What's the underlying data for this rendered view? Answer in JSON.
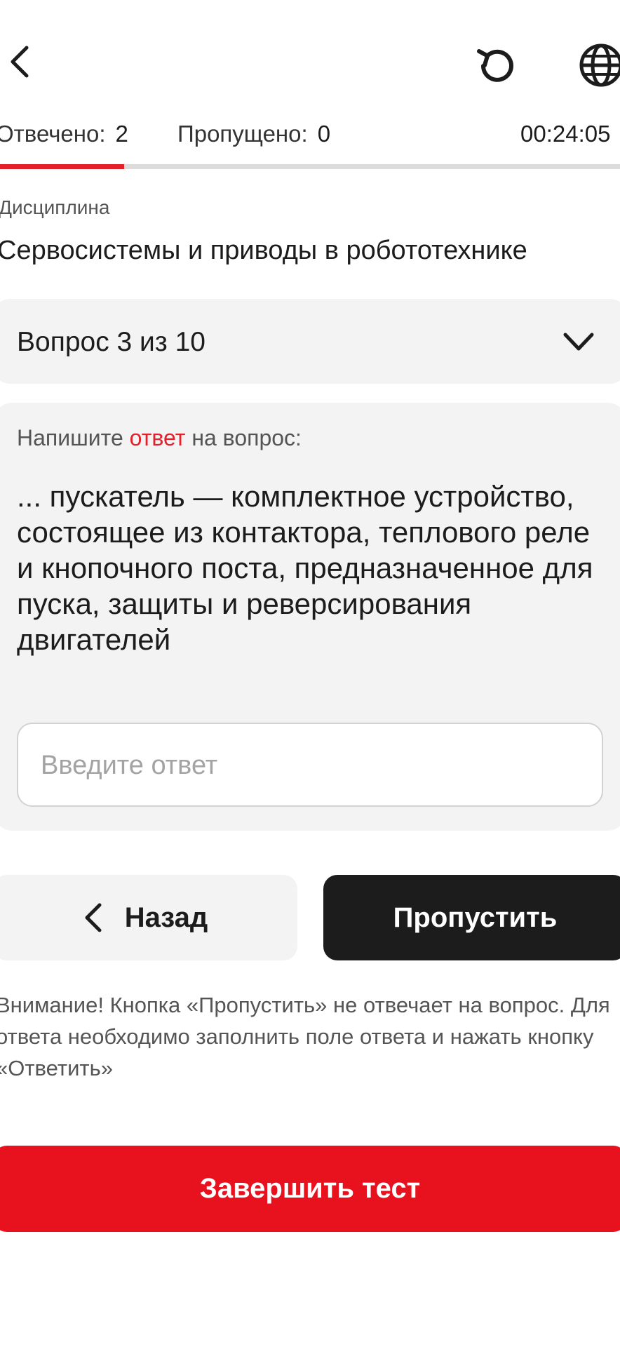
{
  "header": {
    "icons": {
      "back": "chevron-left-icon",
      "reset": "reset-icon",
      "language": "globe-icon"
    }
  },
  "progress": {
    "answered_label": "Отвечено:",
    "answered_value": "2",
    "skipped_label": "Пропущено:",
    "skipped_value": "0",
    "timer": "00:24:05",
    "fraction": 0.2,
    "accent_color": "#e3212b"
  },
  "discipline": {
    "label": "Дисциплина",
    "name": "Сервосистемы и приводы в робототехнике"
  },
  "question_selector": {
    "label": "Вопрос 3 из 10",
    "icon": "chevron-down-icon"
  },
  "question": {
    "prompt_before": "Напишите ",
    "prompt_highlight": "ответ",
    "prompt_after": " на вопрос:",
    "text": "... пускатель — комплектное устройство, состоящее из контактора, теплового реле и кнопочного поста, предназначенное для пуска, защиты и реверсирования двигателей",
    "answer_value": "",
    "answer_placeholder": "Введите ответ"
  },
  "nav": {
    "back_label": "Назад",
    "back_icon": "chevron-left-icon",
    "skip_label": "Пропустить"
  },
  "warning": "Внимание! Кнопка «Пропустить» не отвечает на вопрос. Для ответа необходимо заполнить поле ответа и нажать кнопку «Ответить»",
  "finish_label": "Завершить тест",
  "colors": {
    "primary_red": "#e8121f",
    "dark_button": "#1c1c1c",
    "panel_bg": "#f3f3f3"
  }
}
